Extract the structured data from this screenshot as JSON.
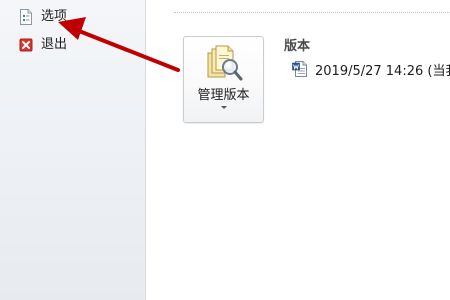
{
  "sidebar": {
    "items": [
      {
        "label": "选项",
        "icon": "options-page-icon"
      },
      {
        "label": "退出",
        "icon": "exit-icon"
      }
    ]
  },
  "main": {
    "manage_button": {
      "label": "管理版本",
      "icon": "manage-versions-icon"
    },
    "versions_section": {
      "title": "版本",
      "entries": [
        {
          "text": "2019/5/27 14:26 (当我",
          "icon": "word-document-icon"
        }
      ]
    }
  },
  "colors": {
    "annotation_arrow": "#c00000",
    "exit_icon": "#d9352b",
    "word_blue": "#2b579a"
  }
}
